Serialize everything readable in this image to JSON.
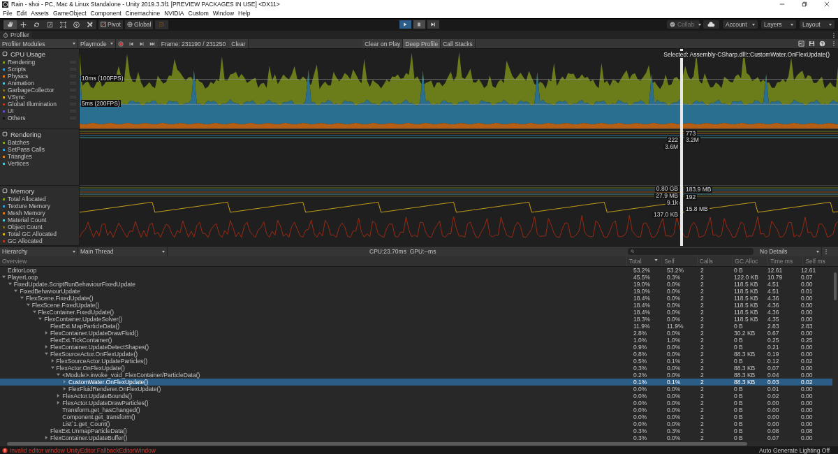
{
  "window": {
    "title": "Rain - shoi - PC, Mac & Linux Standalone - Unity 2019.3.3f1 [PREVIEW PACKAGES IN USE] <DX11>"
  },
  "menu": [
    "File",
    "Edit",
    "Assets",
    "GameObject",
    "Component",
    "Cinemachine",
    "NVIDIA",
    "Custom",
    "Window",
    "Help"
  ],
  "toolbar": {
    "tools": [
      {
        "kind": "hand",
        "selected": true
      },
      {
        "kind": "move",
        "selected": false
      },
      {
        "kind": "rotate",
        "selected": false
      },
      {
        "kind": "scale",
        "selected": false
      },
      {
        "kind": "rect",
        "selected": false
      },
      {
        "kind": "transform",
        "selected": false
      },
      {
        "kind": "custom",
        "selected": false
      }
    ],
    "pivot": "Pivot",
    "global": "Global",
    "play": {
      "on": true
    },
    "pause": {
      "on": false
    },
    "collab": "Collab",
    "account": "Account",
    "layers": "Layers",
    "layout": "Layout"
  },
  "profiler_tab": "Profiler",
  "profiler_toolbar": {
    "modules_dropdown": "Profiler Modules",
    "target": "Playmode",
    "record": true,
    "frame": "Frame: 231190 / 231250",
    "clear": "Clear",
    "toggles": [
      {
        "label": "Clear on Play",
        "on": false
      },
      {
        "label": "Deep Profile",
        "on": true
      },
      {
        "label": "Call Stacks",
        "on": false
      }
    ]
  },
  "selected_sample": "Selected: Assembly-CSharp.dll!::CustomWater.OnFlexUpdate()",
  "modules": [
    {
      "title": "CPU Usage",
      "kind": "cpu",
      "reference_lines": [
        "10ms (100FPS)",
        "5ms (200FPS)"
      ],
      "items": [
        {
          "label": "Rendering",
          "color": "#7ca11a"
        },
        {
          "label": "Scripts",
          "color": "#2e9fd9"
        },
        {
          "label": "Physics",
          "color": "#e07a19"
        },
        {
          "label": "Animation",
          "color": "#4ec5d4"
        },
        {
          "label": "GarbageCollector",
          "color": "#7a6a1a"
        },
        {
          "label": "VSync",
          "color": "#d9b41c"
        },
        {
          "label": "Global Illumination",
          "color": "#b33a1a"
        },
        {
          "label": "UI",
          "color": "#6d4ad0"
        },
        {
          "label": "Others",
          "color": "#111111"
        }
      ]
    },
    {
      "title": "Rendering",
      "kind": "rendering",
      "items": [
        {
          "label": "Batches",
          "color": "#7ca11a"
        },
        {
          "label": "SetPass Calls",
          "color": "#2e9fd9"
        },
        {
          "label": "Triangles",
          "color": "#e07a19"
        },
        {
          "label": "Vertices",
          "color": "#4ec5d4"
        }
      ],
      "value_labels": [
        "773",
        "222",
        "3.2M",
        "3.6M"
      ]
    },
    {
      "title": "Memory",
      "kind": "memory",
      "items": [
        {
          "label": "Total Allocated",
          "color": "#7ca11a"
        },
        {
          "label": "Texture Memory",
          "color": "#2e9fd9"
        },
        {
          "label": "Mesh Memory",
          "color": "#e07a19"
        },
        {
          "label": "Material Count",
          "color": "#4ec5d4"
        },
        {
          "label": "Object Count",
          "color": "#7a6a1a"
        },
        {
          "label": "Total GC Allocated",
          "color": "#d9b41c"
        },
        {
          "label": "GC Allocated",
          "color": "#b33a1a"
        }
      ],
      "value_labels": [
        "0.80 GB",
        "183.9 MB",
        "27.9 MB",
        "192",
        "9.1k",
        "15.8 MB",
        "137.0 KB"
      ]
    }
  ],
  "hierarchy": {
    "view": "Hierarchy",
    "thread": "Main Thread",
    "timing": "CPU:23.70ms  GPU:--ms",
    "details": "No Details",
    "columns": [
      {
        "label": "Overview",
        "sorted": false
      },
      {
        "label": "Total",
        "sorted": true
      },
      {
        "label": "Self",
        "sorted": false
      },
      {
        "label": "Calls",
        "sorted": false
      },
      {
        "label": "GC Alloc",
        "sorted": false
      },
      {
        "label": "Time ms",
        "sorted": false
      },
      {
        "label": "Self ms",
        "sorted": false
      }
    ],
    "rows": [
      {
        "name": "EditorLoop",
        "expandable": false,
        "selected": false,
        "values": [
          "53.2%",
          "53.2%",
          "2",
          "0 B",
          "12.61",
          "12.61"
        ]
      },
      {
        "name": "PlayerLoop",
        "expandable": true,
        "expanded": true,
        "selected": false,
        "values": [
          "45.5%",
          "0.3%",
          "2",
          "122.0 KB",
          "10.79",
          "0.07"
        ],
        "children": [
          {
            "name": "FixedUpdate.ScriptRunBehaviourFixedUpdate",
            "expandable": true,
            "expanded": true,
            "selected": false,
            "values": [
              "19.0%",
              "0.0%",
              "2",
              "118.5 KB",
              "4.51",
              "0.00"
            ],
            "children": [
              {
                "name": "FixedBehaviourUpdate",
                "expandable": true,
                "expanded": true,
                "selected": false,
                "values": [
                  "19.0%",
                  "0.0%",
                  "2",
                  "118.5 KB",
                  "4.51",
                  "0.01"
                ],
                "children": [
                  {
                    "name": "FlexScene.FixedUpdate()",
                    "expandable": true,
                    "expanded": true,
                    "selected": false,
                    "values": [
                      "18.4%",
                      "0.0%",
                      "2",
                      "118.5 KB",
                      "4.36",
                      "0.00"
                    ],
                    "children": [
                      {
                        "name": "FlexScene.FixedUpdate()",
                        "expandable": true,
                        "expanded": true,
                        "selected": false,
                        "values": [
                          "18.4%",
                          "0.0%",
                          "2",
                          "118.5 KB",
                          "4.36",
                          "0.00"
                        ],
                        "children": [
                          {
                            "name": "FlexContainer.FixedUpdate()",
                            "expandable": true,
                            "expanded": true,
                            "selected": false,
                            "values": [
                              "18.4%",
                              "0.0%",
                              "2",
                              "118.5 KB",
                              "4.36",
                              "0.00"
                            ],
                            "children": [
                              {
                                "name": "FlexContainer.UpdateSolver()",
                                "expandable": true,
                                "expanded": true,
                                "selected": false,
                                "values": [
                                  "18.3%",
                                  "0.0%",
                                  "2",
                                  "118.5 KB",
                                  "4.35",
                                  "0.00"
                                ],
                                "children": [
                                  {
                                    "name": "FlexExt.MapParticleData()",
                                    "expandable": false,
                                    "selected": false,
                                    "values": [
                                      "11.9%",
                                      "11.9%",
                                      "2",
                                      "0 B",
                                      "2.83",
                                      "2.83"
                                    ]
                                  },
                                  {
                                    "name": "FlexContainer.UpdateDrawFluid()",
                                    "expandable": true,
                                    "expanded": false,
                                    "selected": false,
                                    "values": [
                                      "2.8%",
                                      "0.0%",
                                      "2",
                                      "30.2 KB",
                                      "0.67",
                                      "0.00"
                                    ]
                                  },
                                  {
                                    "name": "FlexExt.TickContainer()",
                                    "expandable": false,
                                    "selected": false,
                                    "values": [
                                      "1.0%",
                                      "1.0%",
                                      "2",
                                      "0 B",
                                      "0.25",
                                      "0.25"
                                    ]
                                  },
                                  {
                                    "name": "FlexContainer.UpdateDetectShapes()",
                                    "expandable": true,
                                    "expanded": false,
                                    "selected": false,
                                    "values": [
                                      "0.9%",
                                      "0.0%",
                                      "2",
                                      "0 B",
                                      "0.21",
                                      "0.00"
                                    ]
                                  },
                                  {
                                    "name": "FlexSourceActor.OnFlexUpdate()",
                                    "expandable": true,
                                    "expanded": true,
                                    "selected": false,
                                    "values": [
                                      "0.8%",
                                      "0.0%",
                                      "2",
                                      "88.3 KB",
                                      "0.19",
                                      "0.00"
                                    ],
                                    "children": [
                                      {
                                        "name": "FlexSourceActor.UpdateParticles()",
                                        "expandable": true,
                                        "expanded": false,
                                        "selected": false,
                                        "values": [
                                          "0.5%",
                                          "0.1%",
                                          "2",
                                          "0 B",
                                          "0.12",
                                          "0.02"
                                        ]
                                      },
                                      {
                                        "name": "FlexActor.OnFlexUpdate()",
                                        "expandable": true,
                                        "expanded": true,
                                        "selected": false,
                                        "values": [
                                          "0.3%",
                                          "0.0%",
                                          "2",
                                          "88.3 KB",
                                          "0.07",
                                          "0.00"
                                        ],
                                        "children": [
                                          {
                                            "name": "<Module>.invoke_void_FlexContainer/ParticleData()",
                                            "expandable": true,
                                            "expanded": true,
                                            "selected": false,
                                            "values": [
                                              "0.2%",
                                              "0.0%",
                                              "2",
                                              "88.3 KB",
                                              "0.04",
                                              "0.00"
                                            ],
                                            "children": [
                                              {
                                                "name": "CustomWater.OnFlexUpdate()",
                                                "expandable": true,
                                                "expanded": false,
                                                "selected": true,
                                                "values": [
                                                  "0.1%",
                                                  "0.1%",
                                                  "2",
                                                  "88.3 KB",
                                                  "0.03",
                                                  "0.02"
                                                ]
                                              },
                                              {
                                                "name": "FlexFluidRenderer.OnFlexUpdate()",
                                                "expandable": true,
                                                "expanded": false,
                                                "selected": false,
                                                "values": [
                                                  "0.0%",
                                                  "0.0%",
                                                  "2",
                                                  "0 B",
                                                  "0.01",
                                                  "0.00"
                                                ]
                                              }
                                            ]
                                          },
                                          {
                                            "name": "FlexActor.UpdateBounds()",
                                            "expandable": true,
                                            "expanded": false,
                                            "selected": false,
                                            "values": [
                                              "0.0%",
                                              "0.0%",
                                              "2",
                                              "0 B",
                                              "0.02",
                                              "0.00"
                                            ]
                                          },
                                          {
                                            "name": "FlexActor.UpdateDrawParticles()",
                                            "expandable": true,
                                            "expanded": false,
                                            "selected": false,
                                            "values": [
                                              "0.0%",
                                              "0.0%",
                                              "2",
                                              "0 B",
                                              "0.00",
                                              "0.00"
                                            ]
                                          },
                                          {
                                            "name": "Transform.get_hasChanged()",
                                            "expandable": false,
                                            "selected": false,
                                            "values": [
                                              "0.0%",
                                              "0.0%",
                                              "2",
                                              "0 B",
                                              "0.00",
                                              "0.00"
                                            ]
                                          },
                                          {
                                            "name": "Component.get_transform()",
                                            "expandable": false,
                                            "selected": false,
                                            "values": [
                                              "0.0%",
                                              "0.0%",
                                              "2",
                                              "0 B",
                                              "0.00",
                                              "0.00"
                                            ]
                                          },
                                          {
                                            "name": "List`1.get_Count()",
                                            "expandable": false,
                                            "selected": false,
                                            "values": [
                                              "0.0%",
                                              "0.0%",
                                              "2",
                                              "0 B",
                                              "0.00",
                                              "0.00"
                                            ]
                                          }
                                        ]
                                      }
                                    ]
                                  },
                                  {
                                    "name": "FlexExt.UnmapParticleData()",
                                    "expandable": false,
                                    "selected": false,
                                    "values": [
                                      "0.3%",
                                      "0.3%",
                                      "2",
                                      "0 B",
                                      "0.08",
                                      "0.08"
                                    ]
                                  },
                                  {
                                    "name": "FlexContainer.UpdateBuffer()",
                                    "expandable": true,
                                    "expanded": false,
                                    "selected": false,
                                    "values": [
                                      "0.3%",
                                      "0.0%",
                                      "2",
                                      "0 B",
                                      "0.07",
                                      "0.00"
                                    ]
                                  }
                                ]
                              }
                            ]
                          }
                        ]
                      }
                    ]
                  }
                ]
              }
            ]
          }
        ]
      }
    ]
  },
  "status_bar": {
    "error": "Invalid editor window UnityEditor.FallbackEditorWindow",
    "lighting": "Auto Generate Lighting Off"
  }
}
